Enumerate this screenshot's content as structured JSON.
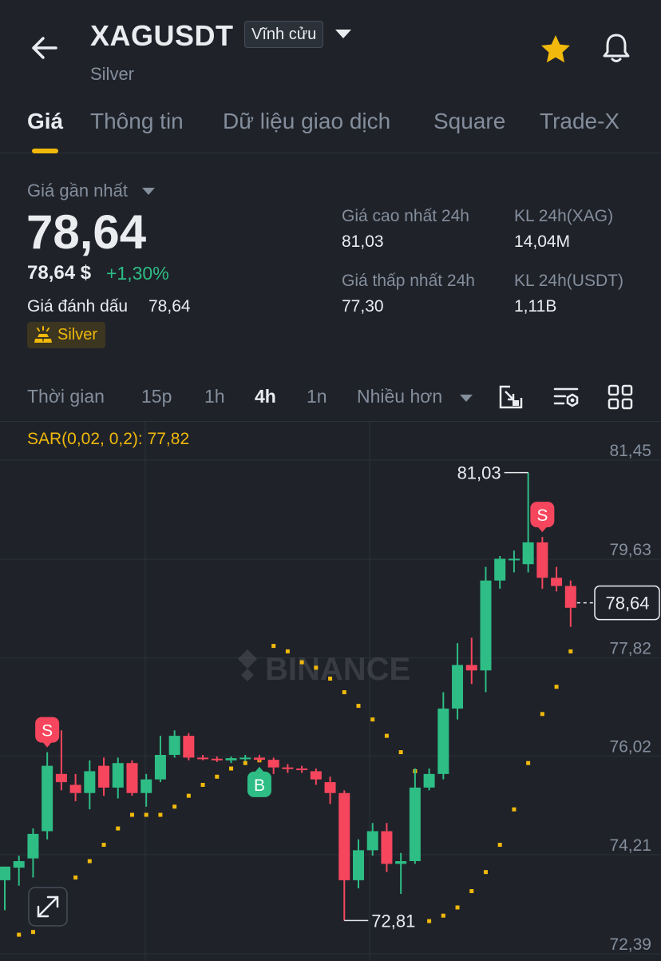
{
  "header": {
    "symbol": "XAGUSDT",
    "contract_type": "Vĩnh cửu",
    "subtitle": "Silver",
    "icons": [
      "back-arrow-icon",
      "chevron-down-icon",
      "star-icon",
      "bell-icon"
    ],
    "star_color": "#f0b90b"
  },
  "tabs": [
    {
      "label": "Giá",
      "active": true
    },
    {
      "label": "Thông tin",
      "active": false
    },
    {
      "label": "Dữ liệu giao dịch",
      "active": false
    },
    {
      "label": "Square",
      "active": false
    },
    {
      "label": "Trade-X",
      "active": false
    }
  ],
  "price": {
    "last_label": "Giá gần nhất",
    "last": "78,64",
    "usd": "78,64 $",
    "change_pct": "+1,30%",
    "mark_label": "Giá đánh dấu",
    "mark_value": "78,64",
    "tag": "Silver"
  },
  "stats": [
    {
      "label": "Giá cao nhất 24h",
      "value": "81,03"
    },
    {
      "label": "KL 24h(XAG)",
      "value": "14,04M"
    },
    {
      "label": "Giá thấp nhất 24h",
      "value": "77,30"
    },
    {
      "label": "KL 24h(USDT)",
      "value": "1,11B"
    }
  ],
  "timeframes": {
    "items": [
      {
        "label": "Thời gian",
        "active": false
      },
      {
        "label": "15p",
        "active": false
      },
      {
        "label": "1h",
        "active": false
      },
      {
        "label": "4h",
        "active": true
      },
      {
        "label": "1n",
        "active": false
      },
      {
        "label": "Nhiều hơn",
        "active": false
      }
    ],
    "tool_icons": [
      "depth-chart-icon",
      "indicator-settings-icon",
      "layout-grid-icon"
    ]
  },
  "indicator": {
    "label": "SAR(0,02, 0,2): 77,82"
  },
  "colors": {
    "up": "#2ebd85",
    "down": "#f6465d",
    "accent": "#f0b90b",
    "background": "#1f2229",
    "muted_text": "#848e9c"
  },
  "chart_data": {
    "type": "candlestick",
    "watermark": "BINANCE",
    "y_axis_labels": [
      "81,45",
      "79,63",
      "77,82",
      "76,02",
      "74,21",
      "72,39"
    ],
    "ylim": [
      72.39,
      81.45
    ],
    "current_price_label": "78,64",
    "current_price": 78.64,
    "high_label": "81,03",
    "high": 81.03,
    "low_label": "72,81",
    "low": 72.81,
    "signals": [
      {
        "label": "S",
        "candle": 3
      },
      {
        "label": "B",
        "candle": 18
      },
      {
        "label": "S",
        "candle": 38
      }
    ],
    "candles": [
      {
        "o": 73.55,
        "h": 73.8,
        "l": 73.0,
        "c": 73.8
      },
      {
        "o": 73.78,
        "h": 74.0,
        "l": 73.45,
        "c": 73.9
      },
      {
        "o": 73.95,
        "h": 74.5,
        "l": 73.6,
        "c": 74.4
      },
      {
        "o": 74.45,
        "h": 75.9,
        "l": 74.3,
        "c": 75.65
      },
      {
        "o": 75.5,
        "h": 76.3,
        "l": 75.2,
        "c": 75.35
      },
      {
        "o": 75.3,
        "h": 75.5,
        "l": 75.0,
        "c": 75.15
      },
      {
        "o": 75.15,
        "h": 75.75,
        "l": 74.85,
        "c": 75.55
      },
      {
        "o": 75.65,
        "h": 75.8,
        "l": 75.1,
        "c": 75.25
      },
      {
        "o": 75.25,
        "h": 75.8,
        "l": 75.05,
        "c": 75.7
      },
      {
        "o": 75.7,
        "h": 75.75,
        "l": 75.1,
        "c": 75.15
      },
      {
        "o": 75.15,
        "h": 75.5,
        "l": 74.9,
        "c": 75.4
      },
      {
        "o": 75.4,
        "h": 76.2,
        "l": 75.35,
        "c": 75.85
      },
      {
        "o": 75.85,
        "h": 76.3,
        "l": 75.8,
        "c": 76.2
      },
      {
        "o": 76.2,
        "h": 76.25,
        "l": 75.75,
        "c": 75.8
      },
      {
        "o": 75.8,
        "h": 75.85,
        "l": 75.75,
        "c": 75.78
      },
      {
        "o": 75.78,
        "h": 75.82,
        "l": 75.72,
        "c": 75.75
      },
      {
        "o": 75.75,
        "h": 75.82,
        "l": 75.7,
        "c": 75.79
      },
      {
        "o": 75.79,
        "h": 75.85,
        "l": 75.74,
        "c": 75.8
      },
      {
        "o": 75.8,
        "h": 75.85,
        "l": 75.72,
        "c": 75.76
      },
      {
        "o": 75.76,
        "h": 75.8,
        "l": 75.5,
        "c": 75.62
      },
      {
        "o": 75.62,
        "h": 75.68,
        "l": 75.52,
        "c": 75.6
      },
      {
        "o": 75.6,
        "h": 75.65,
        "l": 75.52,
        "c": 75.58
      },
      {
        "o": 75.55,
        "h": 75.6,
        "l": 75.3,
        "c": 75.4
      },
      {
        "o": 75.35,
        "h": 75.45,
        "l": 74.95,
        "c": 75.15
      },
      {
        "o": 75.15,
        "h": 75.2,
        "l": 72.81,
        "c": 73.55
      },
      {
        "o": 73.55,
        "h": 74.3,
        "l": 73.4,
        "c": 74.1
      },
      {
        "o": 74.1,
        "h": 74.6,
        "l": 74.0,
        "c": 74.45
      },
      {
        "o": 74.45,
        "h": 74.6,
        "l": 73.7,
        "c": 73.85
      },
      {
        "o": 73.85,
        "h": 74.05,
        "l": 73.3,
        "c": 73.9
      },
      {
        "o": 73.9,
        "h": 75.6,
        "l": 73.85,
        "c": 75.25
      },
      {
        "o": 75.25,
        "h": 75.6,
        "l": 75.2,
        "c": 75.5
      },
      {
        "o": 75.5,
        "h": 77.0,
        "l": 75.4,
        "c": 76.7
      },
      {
        "o": 76.7,
        "h": 77.9,
        "l": 76.5,
        "c": 77.5
      },
      {
        "o": 77.5,
        "h": 78.0,
        "l": 77.15,
        "c": 77.4
      },
      {
        "o": 77.4,
        "h": 79.3,
        "l": 77.0,
        "c": 79.05
      },
      {
        "o": 79.05,
        "h": 79.5,
        "l": 78.9,
        "c": 79.45
      },
      {
        "o": 79.45,
        "h": 79.6,
        "l": 79.2,
        "c": 79.45
      },
      {
        "o": 79.35,
        "h": 81.03,
        "l": 79.2,
        "c": 79.75
      },
      {
        "o": 79.75,
        "h": 79.85,
        "l": 78.9,
        "c": 79.1
      },
      {
        "o": 79.1,
        "h": 79.3,
        "l": 78.85,
        "c": 78.95
      },
      {
        "o": 78.95,
        "h": 79.05,
        "l": 78.2,
        "c": 78.55
      }
    ],
    "sar": [
      {
        "candle": 1,
        "v": 72.55
      },
      {
        "candle": 2,
        "v": 72.6
      },
      {
        "candle": 3,
        "v": 73.0
      },
      {
        "candle": 4,
        "v": 73.35
      },
      {
        "candle": 5,
        "v": 73.6
      },
      {
        "candle": 6,
        "v": 73.9
      },
      {
        "candle": 7,
        "v": 74.2
      },
      {
        "candle": 8,
        "v": 74.5
      },
      {
        "candle": 9,
        "v": 74.75
      },
      {
        "candle": 10,
        "v": 74.75
      },
      {
        "candle": 11,
        "v": 74.75
      },
      {
        "candle": 12,
        "v": 74.9
      },
      {
        "candle": 13,
        "v": 75.1
      },
      {
        "candle": 14,
        "v": 75.3
      },
      {
        "candle": 15,
        "v": 75.45
      },
      {
        "candle": 16,
        "v": 75.6
      },
      {
        "candle": 17,
        "v": 75.7
      },
      {
        "candle": 18,
        "v": 75.75
      },
      {
        "candle": 19,
        "v": 77.85
      },
      {
        "candle": 20,
        "v": 77.75
      },
      {
        "candle": 21,
        "v": 77.55
      },
      {
        "candle": 22,
        "v": 77.45
      },
      {
        "candle": 23,
        "v": 77.25
      },
      {
        "candle": 24,
        "v": 77.0
      },
      {
        "candle": 25,
        "v": 76.75
      },
      {
        "candle": 26,
        "v": 76.5
      },
      {
        "candle": 27,
        "v": 76.2
      },
      {
        "candle": 28,
        "v": 75.9
      },
      {
        "candle": 29,
        "v": 75.55
      },
      {
        "candle": 30,
        "v": 72.8
      },
      {
        "candle": 31,
        "v": 72.9
      },
      {
        "candle": 32,
        "v": 73.05
      },
      {
        "candle": 33,
        "v": 73.35
      },
      {
        "candle": 34,
        "v": 73.7
      },
      {
        "candle": 35,
        "v": 74.2
      },
      {
        "candle": 36,
        "v": 74.85
      },
      {
        "candle": 37,
        "v": 75.7
      },
      {
        "candle": 38,
        "v": 76.6
      },
      {
        "candle": 39,
        "v": 77.1
      },
      {
        "candle": 40,
        "v": 77.75
      }
    ]
  }
}
